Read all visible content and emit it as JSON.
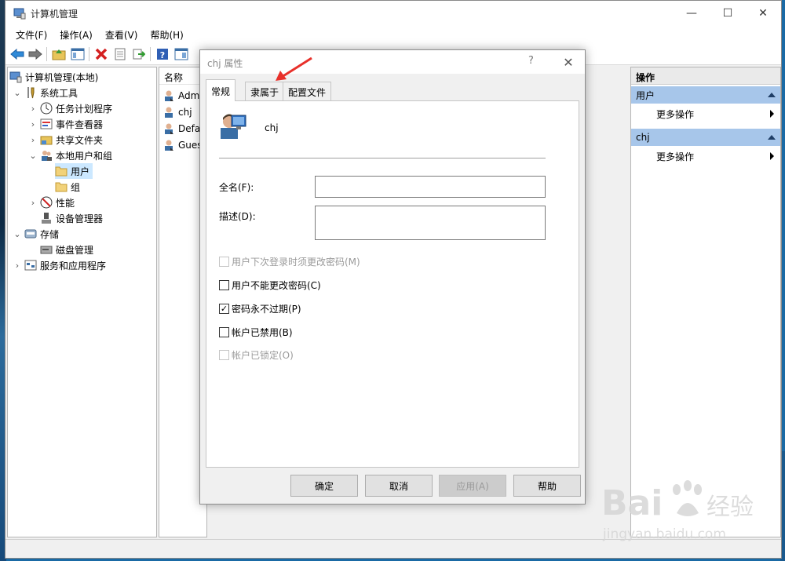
{
  "window": {
    "title": "计算机管理",
    "controls": {
      "minimize": "—",
      "maximize": "☐",
      "close": "✕"
    }
  },
  "menu": [
    "文件(F)",
    "操作(A)",
    "查看(V)",
    "帮助(H)"
  ],
  "tree": [
    {
      "label": "计算机管理(本地)",
      "arrow": "",
      "icon": "computer-management-icon"
    },
    {
      "label": "系统工具",
      "arrow": "⌄",
      "icon": "tools-icon"
    },
    {
      "label": "任务计划程序",
      "arrow": "›",
      "icon": "clock-icon"
    },
    {
      "label": "事件查看器",
      "arrow": "›",
      "icon": "event-viewer-icon"
    },
    {
      "label": "共享文件夹",
      "arrow": "›",
      "icon": "shared-folder-icon"
    },
    {
      "label": "本地用户和组",
      "arrow": "⌄",
      "icon": "users-icon"
    },
    {
      "label": "用户",
      "arrow": "",
      "icon": "folder-icon"
    },
    {
      "label": "组",
      "arrow": "",
      "icon": "folder-icon"
    },
    {
      "label": "性能",
      "arrow": "›",
      "icon": "performance-icon"
    },
    {
      "label": "设备管理器",
      "arrow": "",
      "icon": "device-manager-icon"
    },
    {
      "label": "存储",
      "arrow": "⌄",
      "icon": "storage-icon"
    },
    {
      "label": "磁盘管理",
      "arrow": "",
      "icon": "disk-icon"
    },
    {
      "label": "服务和应用程序",
      "arrow": "›",
      "icon": "services-icon"
    }
  ],
  "list": {
    "header": "名称",
    "rows": [
      "Admi",
      "chj",
      "Defau",
      "Guest"
    ]
  },
  "actions": {
    "title": "操作",
    "sections": [
      {
        "label": "用户",
        "item": "更多操作"
      },
      {
        "label": "chj",
        "item": "更多操作"
      }
    ]
  },
  "dialog": {
    "title": "chj 属性",
    "help": "?",
    "close": "✕",
    "tabs": [
      "常规",
      "隶属于",
      "配置文件"
    ],
    "active_tab": 0,
    "user_name": "chj",
    "fullname_label": "全名(F):",
    "fullname_value": "",
    "description_label": "描述(D):",
    "description_value": "",
    "checkboxes": [
      {
        "label": "用户下次登录时须更改密码(M)",
        "checked": false,
        "disabled": true
      },
      {
        "label": "用户不能更改密码(C)",
        "checked": false,
        "disabled": false
      },
      {
        "label": "密码永不过期(P)",
        "checked": true,
        "disabled": false
      },
      {
        "label": "帐户已禁用(B)",
        "checked": false,
        "disabled": false
      },
      {
        "label": "帐户已锁定(O)",
        "checked": false,
        "disabled": true
      }
    ],
    "buttons": {
      "ok": "确定",
      "cancel": "取消",
      "apply": "应用(A)",
      "help": "帮助"
    }
  },
  "watermark": {
    "brand": "Bai",
    "brand2": "du",
    "cn": "经验",
    "url": "jingyan.baidu.com"
  },
  "colors": {
    "accent": "#a7c6ea",
    "selection": "#cce8ff",
    "annotation": "#e8302a"
  }
}
